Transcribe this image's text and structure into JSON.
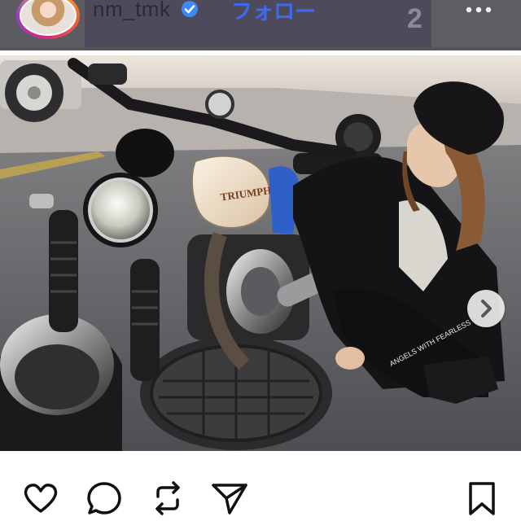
{
  "header": {
    "username": "nm_tmk",
    "follow_label": "フォロー",
    "counter_text": "2"
  },
  "icons": {
    "avatar": "profile-avatar",
    "verified": "verified-badge-icon",
    "more": "more-options-icon",
    "next": "chevron-right-icon",
    "like": "heart-icon",
    "comment": "comment-bubble-icon",
    "repost": "repost-icon",
    "share": "send-paper-plane-icon",
    "save": "bookmark-icon"
  },
  "photo": {
    "tank_brand": "TRIUMPH",
    "sleeve_text": "ANGELS WITH FEARLESS"
  },
  "colors": {
    "accent_blue": "#3d6bf0",
    "verified_blue": "#3d8af7",
    "icon_black": "#111111"
  }
}
